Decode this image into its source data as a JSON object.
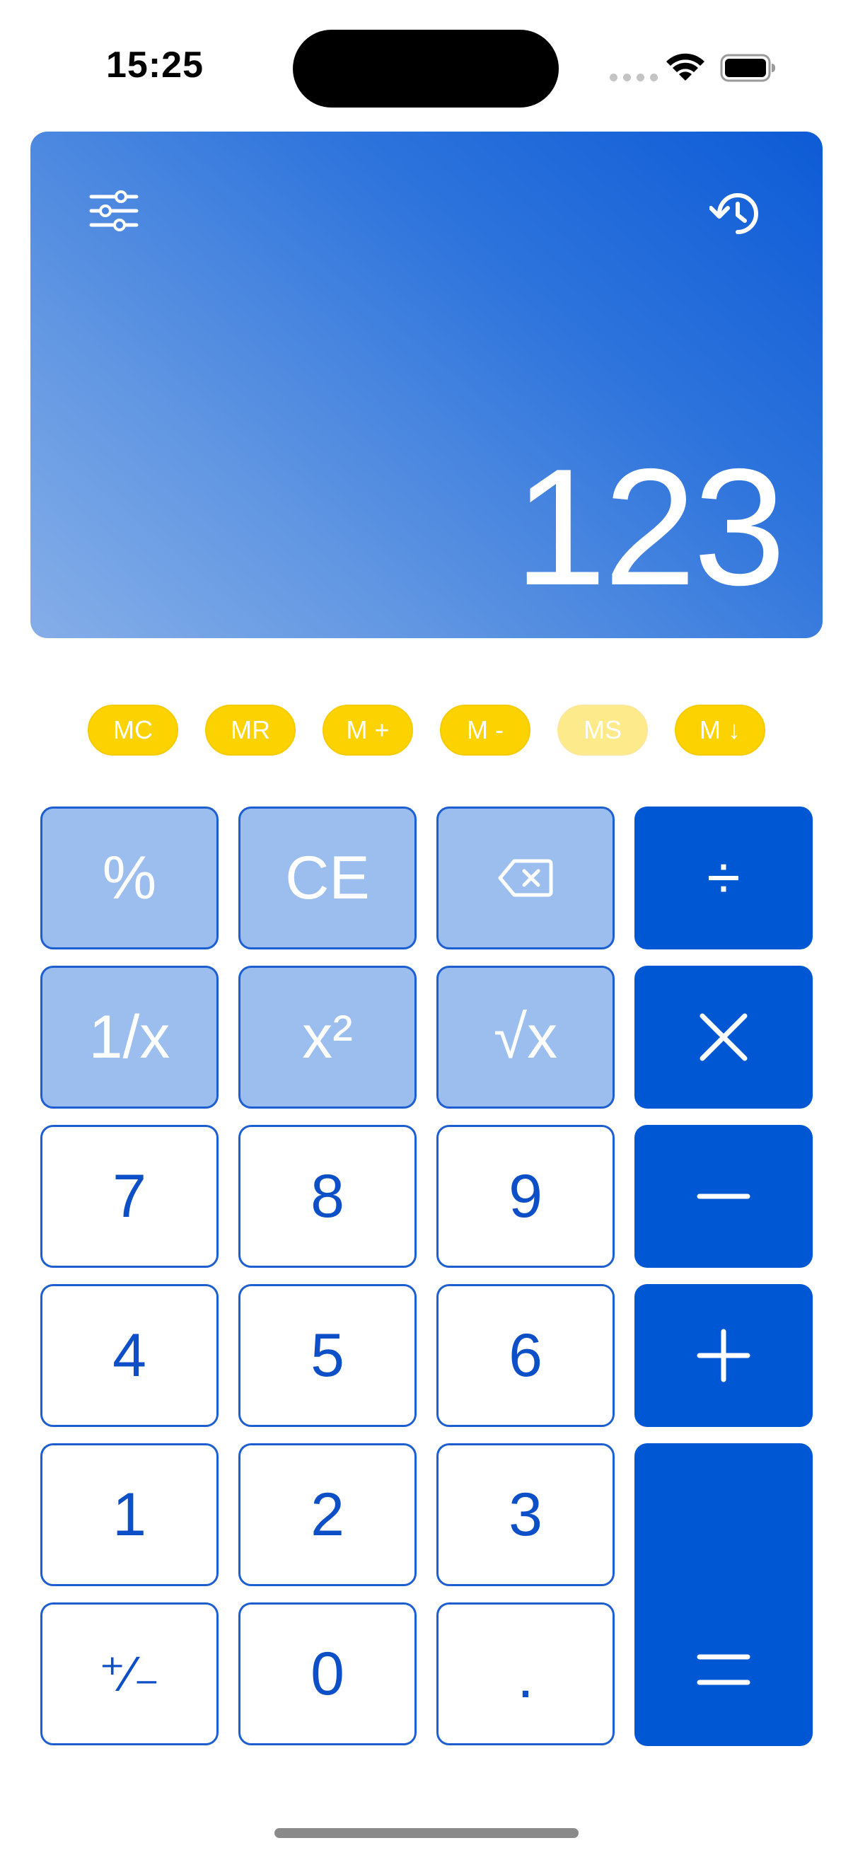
{
  "status_bar": {
    "time": "15:25"
  },
  "display": {
    "value": "123"
  },
  "memory": [
    {
      "label": "MC",
      "enabled": true
    },
    {
      "label": "MR",
      "enabled": true
    },
    {
      "label": "M +",
      "enabled": true
    },
    {
      "label": "M -",
      "enabled": true
    },
    {
      "label": "MS",
      "enabled": false
    },
    {
      "label": "M ↓",
      "enabled": true
    }
  ],
  "keys": {
    "percent": "%",
    "ce": "CE",
    "backspace": "",
    "divide": "÷",
    "reciprocal": "1/x",
    "square": "x²",
    "sqrt": "√x",
    "multiply": "",
    "seven": "7",
    "eight": "8",
    "nine": "9",
    "minus": "",
    "four": "4",
    "five": "5",
    "six": "6",
    "plus": "",
    "one": "1",
    "two": "2",
    "three": "3",
    "equals": "",
    "negate": "⁺∕₋",
    "zero": "0",
    "decimal": "."
  },
  "colors": {
    "primary": "#0057d3",
    "function_key": "#9bbeef",
    "memory": "#fdd201",
    "memory_disabled": "#fdeb8b"
  },
  "icons": [
    "settings-sliders-icon",
    "history-icon",
    "backspace-icon",
    "wifi-icon",
    "battery-icon"
  ]
}
